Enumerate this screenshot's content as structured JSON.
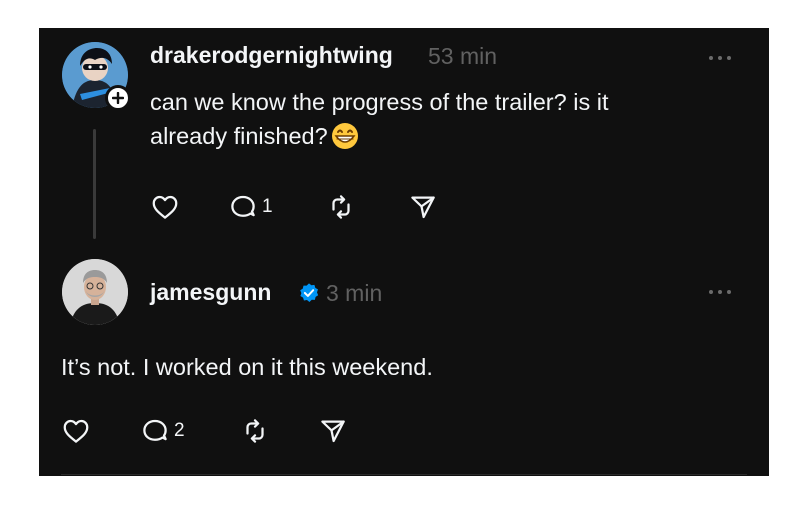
{
  "post": {
    "username": "drakerodgernightwing",
    "time": "53 min",
    "text_line1": "can we know the progress of the trailer? is it",
    "text_line2": "already finished?",
    "emoji": "grinning-face-emoji",
    "reply_count": "1"
  },
  "reply": {
    "username": "jamesgunn",
    "time": "3 min",
    "verified": true,
    "text": "It’s not. I worked on it this weekend.",
    "reply_count": "2"
  },
  "icons": {
    "like": "heart-icon",
    "comment": "comment-icon",
    "repost": "repost-icon",
    "share": "send-icon",
    "more": "more-options-icon"
  },
  "colors": {
    "background": "#101010",
    "text": "#f3f5f7",
    "muted": "#616161",
    "verified": "#0095f6"
  }
}
